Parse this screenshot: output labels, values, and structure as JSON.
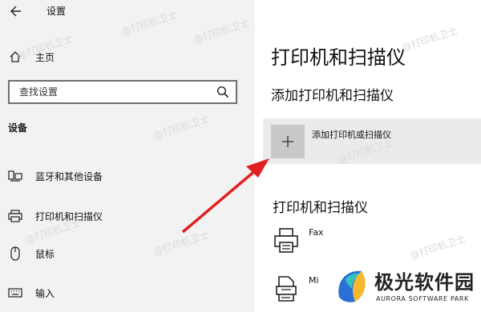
{
  "window": {
    "title": "设置"
  },
  "sidebar": {
    "home_label": "主页",
    "search": {
      "placeholder": "查找设置",
      "value": ""
    },
    "section_title": "设备",
    "items": [
      {
        "label": "蓝牙和其他设备",
        "icon": "bluetooth-devices-icon"
      },
      {
        "label": "打印机和扫描仪",
        "icon": "printer-icon"
      },
      {
        "label": "鼠标",
        "icon": "mouse-icon"
      },
      {
        "label": "输入",
        "icon": "keyboard-icon"
      }
    ]
  },
  "main": {
    "page_title": "打印机和扫描仪",
    "add_section_title": "添加打印机和扫描仪",
    "add_button_label": "添加打印机或扫描仪",
    "list_title": "打印机和扫描仪",
    "devices": [
      {
        "name": "Fax",
        "icon": "fax-printer-icon"
      },
      {
        "name": "Mi",
        "icon": "document-printer-icon"
      }
    ]
  },
  "watermark": {
    "text": "@打印机卫士"
  },
  "brand": {
    "name": "极光软件园",
    "sub": "AURORA SOFTWARE PARK"
  },
  "colors": {
    "sidebar_bg": "#f2f2f2",
    "content_bg": "#ffffff",
    "add_row_bg": "#ebebeb",
    "add_tile_bg": "#c8c8c8",
    "annotation_arrow": "#e02020"
  }
}
